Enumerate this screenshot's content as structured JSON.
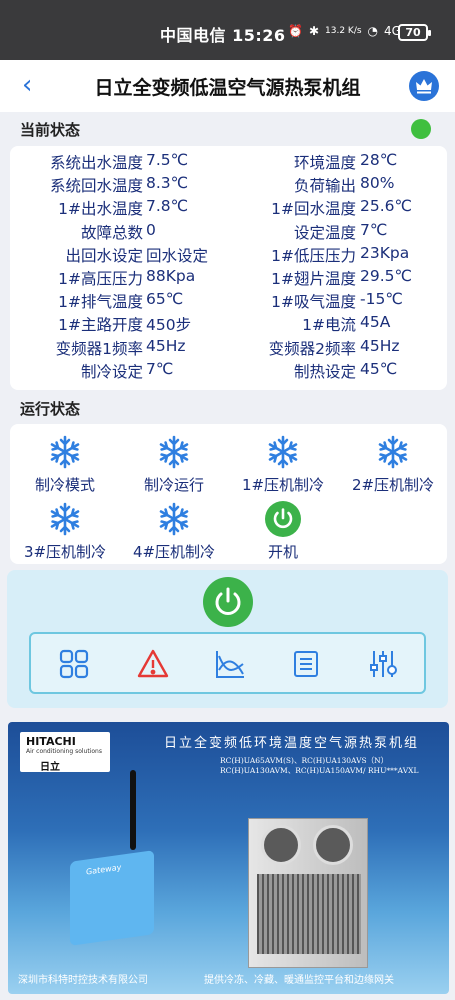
{
  "status_bar": {
    "carrier": "中国电信",
    "time": "15:26",
    "network": "13.2 K/s",
    "signal": "4G",
    "battery": "70"
  },
  "header": {
    "title": "日立全变频低温空气源热泵机组"
  },
  "sections": {
    "current": "当前状态",
    "running": "运行状态"
  },
  "status_rows": [
    {
      "l1": "系统出水温度",
      "v1": "7.5℃",
      "l2": "环境温度",
      "v2": "28℃"
    },
    {
      "l1": "系统回水温度",
      "v1": "8.3℃",
      "l2": "负荷输出",
      "v2": "80%"
    },
    {
      "l1": "1#出水温度",
      "v1": "7.8℃",
      "l2": "1#回水温度",
      "v2": "25.6℃"
    },
    {
      "l1": "故障总数",
      "v1": "0",
      "l2": "设定温度",
      "v2": "7℃"
    },
    {
      "l1": "出回水设定",
      "v1": "回水设定",
      "l2": "1#低压压力",
      "v2": "23Kpa"
    },
    {
      "l1": "1#高压压力",
      "v1": "88Kpa",
      "l2": "1#翅片温度",
      "v2": "29.5℃"
    },
    {
      "l1": "1#排气温度",
      "v1": "65℃",
      "l2": "1#吸气温度",
      "v2": "-15℃"
    },
    {
      "l1": "1#主路开度",
      "v1": "450步",
      "l2": "1#电流",
      "v2": "45A"
    },
    {
      "l1": "变频器1频率",
      "v1": "45Hz",
      "l2": "变频器2频率",
      "v2": "45Hz"
    },
    {
      "l1": "制冷设定",
      "v1": "7℃",
      "l2": "制热设定",
      "v2": "45℃"
    }
  ],
  "run_items": [
    {
      "label": "制冷模式",
      "icon": "snowflake-icon"
    },
    {
      "label": "制冷运行",
      "icon": "snowflake-icon"
    },
    {
      "label": "1#压机制冷",
      "icon": "snowflake-icon"
    },
    {
      "label": "2#压机制冷",
      "icon": "snowflake-icon"
    },
    {
      "label": "3#压机制冷",
      "icon": "snowflake-icon"
    },
    {
      "label": "4#压机制冷",
      "icon": "snowflake-icon"
    },
    {
      "label": "开机",
      "icon": "power-icon"
    }
  ],
  "toolbar": [
    "grid-icon",
    "warning-icon",
    "chart-icon",
    "list-icon",
    "sliders-icon"
  ],
  "banner": {
    "brand": "HITACHI",
    "brand_sub": "Air conditioning solutions",
    "brand_cn": "日立",
    "title": "日立全变频低环境温度空气源热泵机组",
    "models": [
      "RC(H)UA65AVM(S)、RC(H)UA130AVS（N）",
      "RC(H)UA130AVM、RC(H)UA150AVM/ RHU***AVXL"
    ],
    "device_label": "Gateway",
    "footer_left": "深圳市科特时控技术有限公司",
    "footer_right": "提供冷冻、冷藏、暖通监控平台和边缘网关"
  },
  "colors": {
    "accent": "#2a73d8",
    "ok": "#3fbf3f",
    "text": "#1b2f7a",
    "icon_blue": "#2f7fe0",
    "alarm": "#e53935"
  }
}
